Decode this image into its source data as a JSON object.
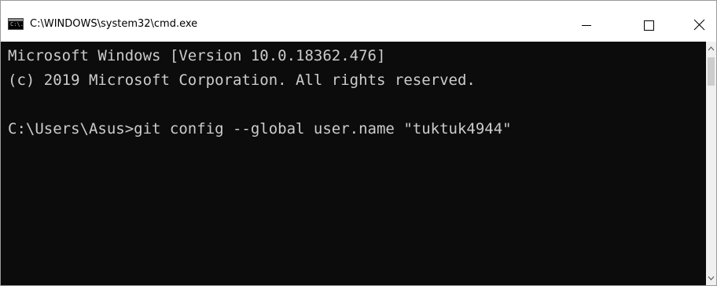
{
  "window": {
    "title": "C:\\WINDOWS\\system32\\cmd.exe",
    "icon": "cmd-icon",
    "icon_text": "C:\\."
  },
  "controls": {
    "minimize_icon": "minimize-icon",
    "maximize_icon": "maximize-icon",
    "close_icon": "close-icon"
  },
  "console": {
    "background": "#0c0c0c",
    "foreground": "#cccccc",
    "lines": [
      "Microsoft Windows [Version 10.0.18362.476]",
      "(c) 2019 Microsoft Corporation. All rights reserved.",
      "",
      "C:\\Users\\Asus>git config --global user.name \"tuktuk4944\""
    ]
  }
}
